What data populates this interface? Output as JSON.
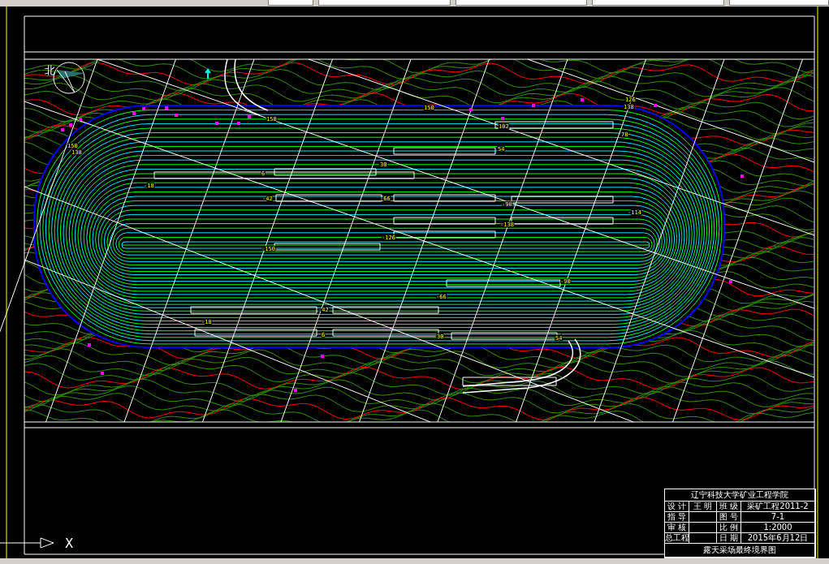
{
  "drawing": {
    "north_label": "北",
    "axis_label": "X",
    "bench_labels": [
      "150",
      "138",
      "150",
      "150",
      "126",
      "138",
      "102",
      "78",
      "54",
      "30",
      "6",
      "-18",
      "-42",
      "-66",
      "-90",
      "-114",
      "-138",
      "-126",
      "-150",
      "-90",
      "-66",
      "-42",
      "6",
      "30",
      "54",
      "-18"
    ]
  },
  "title_block": {
    "header": "辽宁科技大学矿业工程学院",
    "rows": [
      {
        "role": "设 计",
        "name": "王 明",
        "field": "班 级",
        "value": "采矿工程2011-2"
      },
      {
        "role": "指 导",
        "field": "图 号",
        "value": "7-1"
      },
      {
        "role": "审 核",
        "field": "比 例",
        "value": "1:2000"
      },
      {
        "role": "总工程",
        "field": "日 期",
        "value": "2015年6月12日"
      }
    ],
    "footer": "露天采场最终境界图"
  }
}
